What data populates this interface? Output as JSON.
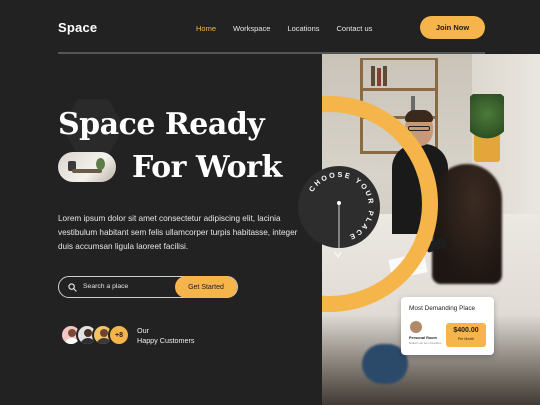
{
  "brand": {
    "logo": "Space",
    "accent": "#f5b54a"
  },
  "nav": {
    "items": [
      "Home",
      "Workspace",
      "Locations",
      "Contact us"
    ],
    "active": "Home",
    "cta": "Join Now"
  },
  "hero": {
    "title_line1": "Space Ready",
    "title_line2": "For Work",
    "description": "Lorem ipsum dolor sit amet consectetur adipiscing elit, lacinia vestibulum habitant sem felis ullamcorper turpis habitasse, integer duis accumsan ligula laoreet facilisi.",
    "circle_text": "CHOOSE YOUR PLACE"
  },
  "search": {
    "placeholder": "Search a place",
    "button": "Get Started"
  },
  "customers": {
    "more": "+8",
    "label_line1": "Our",
    "label_line2": "Happy Customers"
  },
  "card": {
    "title": "Most Demanding Place",
    "person": "Personal Room",
    "person_sub": "Nullam vel sem faucibus",
    "price": "$400.00",
    "period": "Per Month"
  }
}
